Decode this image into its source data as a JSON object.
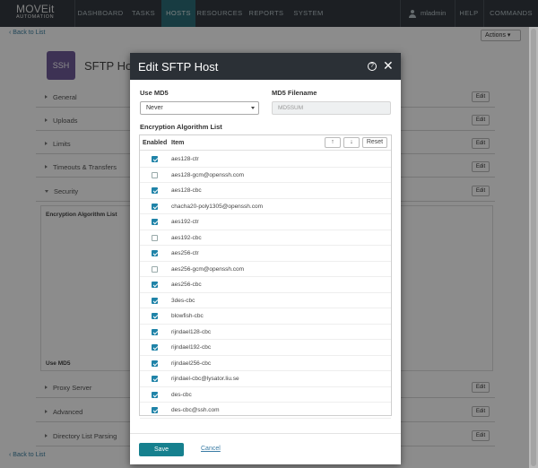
{
  "app": {
    "logo_main": "MOVEit",
    "logo_sub": "AUTOMATION"
  },
  "nav": {
    "items": [
      "DASHBOARD",
      "TASKS",
      "HOSTS",
      "RESOURCES",
      "REPORTS",
      "SYSTEM"
    ],
    "active": "HOSTS",
    "user": "mladmin",
    "help": "HELP",
    "commands": "COMMANDS"
  },
  "page": {
    "back_label": "Back to List",
    "actions_label": "Actions",
    "badge": "SSH",
    "title": "SFTP Host",
    "sections": [
      "General",
      "Uploads",
      "Limits",
      "Timeouts & Transfers",
      "Security",
      "Proxy Server",
      "Advanced",
      "Directory List Parsing"
    ],
    "edit_label": "Edit",
    "security_body_title": "Encryption Algorithm List",
    "security_body_md5": "Use MD5"
  },
  "modal": {
    "title": "Edit SFTP Host",
    "use_md5_label": "Use MD5",
    "use_md5_value": "Never",
    "md5_filename_label": "MD5 Filename",
    "md5_filename_placeholder": "MD5SUM",
    "list_title": "Encryption Algorithm List",
    "col_enabled": "Enabled",
    "col_item": "Item",
    "btn_up": "↑",
    "btn_down": "↓",
    "btn_reset": "Reset",
    "algorithms": [
      {
        "name": "aes128-ctr",
        "enabled": true
      },
      {
        "name": "aes128-gcm@openssh.com",
        "enabled": false
      },
      {
        "name": "aes128-cbc",
        "enabled": true
      },
      {
        "name": "chacha20-poly1305@openssh.com",
        "enabled": true
      },
      {
        "name": "aes192-ctr",
        "enabled": true
      },
      {
        "name": "aes192-cbc",
        "enabled": false
      },
      {
        "name": "aes256-ctr",
        "enabled": true
      },
      {
        "name": "aes256-gcm@openssh.com",
        "enabled": false
      },
      {
        "name": "aes256-cbc",
        "enabled": true
      },
      {
        "name": "3des-cbc",
        "enabled": true
      },
      {
        "name": "blowfish-cbc",
        "enabled": true
      },
      {
        "name": "rijndael128-cbc",
        "enabled": true
      },
      {
        "name": "rijndael192-cbc",
        "enabled": true
      },
      {
        "name": "rijndael256-cbc",
        "enabled": true
      },
      {
        "name": "rijndael-cbc@lysator.liu.se",
        "enabled": true
      },
      {
        "name": "des-cbc",
        "enabled": true
      },
      {
        "name": "des-cbc@ssh.com",
        "enabled": true
      }
    ],
    "save_label": "Save",
    "cancel_label": "Cancel"
  },
  "colors": {
    "nav_bg": "#333a40",
    "nav_active": "#2d6e78",
    "modal_head": "#2b3036",
    "accent": "#16808e",
    "checkbox": "#1f83a8",
    "badge": "#6f5b9a"
  }
}
